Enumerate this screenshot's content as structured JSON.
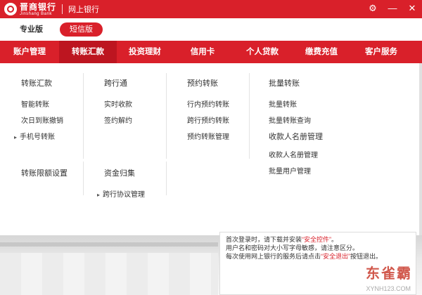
{
  "titlebar": {
    "logo_cn": "晋商银行",
    "logo_en": "Jinshang Bank",
    "title": "网上银行",
    "icons": [
      "gear-icon",
      "minimize-icon",
      "close-icon"
    ]
  },
  "versions": {
    "pro": "专业版",
    "sms": "短信版"
  },
  "nav": [
    "账户管理",
    "转账汇款",
    "投资理财",
    "信用卡",
    "个人贷款",
    "缴费充值",
    "客户服务"
  ],
  "panel": {
    "col1": {
      "head": "转账汇款",
      "items": [
        "智能转账",
        "次日到账撤销",
        "手机号转账"
      ]
    },
    "col2": {
      "head": "跨行通",
      "items": [
        "实时收款",
        "签约解约"
      ]
    },
    "col3": {
      "head": "预约转账",
      "items": [
        "行内预约转账",
        "跨行预约转账",
        "预约转账管理"
      ]
    },
    "col4": {
      "head": "批量转账",
      "items": [
        "批量转账",
        "批量转账查询"
      ],
      "head2": "收款人名册管理",
      "items2": [
        "收款人名册管理",
        "批量用户管理"
      ]
    },
    "col5": {
      "head": "转账限额设置"
    },
    "col6": {
      "head": "资金归集",
      "items": [
        "跨行协议管理"
      ]
    }
  },
  "notice": {
    "line1_a": "首次登录时，请下载并安装",
    "line1_b": "“安全控件”",
    "line1_c": "。",
    "line2": "用户名和密码对大小写字母敏感，请注意区分。",
    "line3_a": "每次使用网上银行的服务后请点击",
    "line3_b": "“安全退出”",
    "line3_c": "按钮退出。"
  },
  "watermark": {
    "text": "东雀霸",
    "url": "XYNH123.COM"
  },
  "colors": {
    "brand": "#d9202a",
    "active_nav": "#bd1520"
  }
}
